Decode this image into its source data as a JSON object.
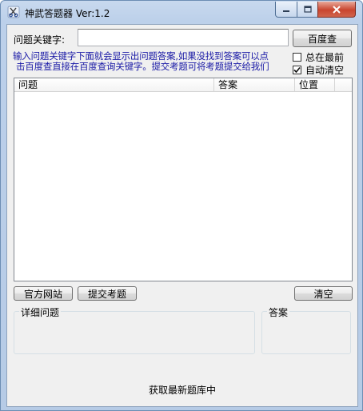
{
  "window": {
    "title": "神武答题器 Ver:1.2",
    "icons": {
      "app": "scissors-app-icon",
      "minimize": "minimize-icon",
      "maximize": "maximize-icon",
      "close": "close-icon"
    },
    "colors": {
      "frame": "#bcd0ea",
      "close_button": "#c9452f",
      "hint_text": "#1a1aa6"
    }
  },
  "search": {
    "label": "问题关键字:",
    "value": "",
    "button_label": "百度查"
  },
  "hint": {
    "line1": "输入问题关键字下面就会显示出问题答案,如果没找到答案可以点",
    "line2": "击百度查直接在百度查询关键字。提交考题可将考题提交给我们"
  },
  "options": {
    "always_on_top": {
      "label": "总在最前",
      "checked": false
    },
    "auto_clear": {
      "label": "自动清空",
      "checked": true
    }
  },
  "results_table": {
    "columns": [
      "问题",
      "答案",
      "位置"
    ],
    "rows": []
  },
  "buttons": {
    "official_site": "官方网站",
    "submit_question": "提交考题",
    "clear": "清空"
  },
  "detail": {
    "question_title": "详细问题",
    "question_text": "",
    "answer_title": "答案",
    "answer_text": ""
  },
  "status": {
    "text": "获取最新题库中"
  }
}
